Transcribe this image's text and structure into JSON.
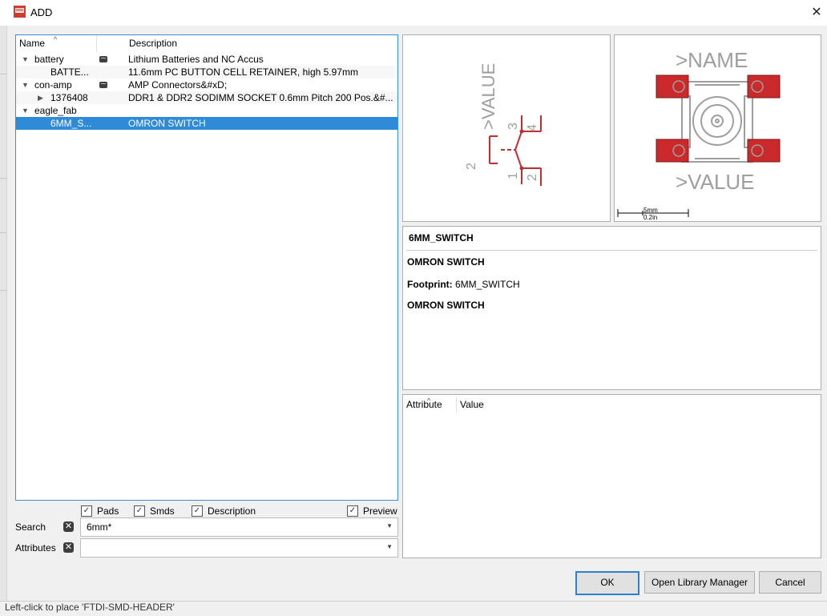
{
  "window": {
    "title": "ADD",
    "close_glyph": "✕",
    "icon": "eagle-sch-icon"
  },
  "tree": {
    "col_name": "Name",
    "col_desc": "Description",
    "sort_caret": "^",
    "rows": [
      {
        "name": "battery",
        "desc": "Lithium Batteries and NC Accus"
      },
      {
        "name": "BATTE...",
        "desc": "11.6mm PC BUTTON CELL RETAINER, high 5.97mm"
      },
      {
        "name": "con-amp",
        "desc": "AMP Connectors&#xD;"
      },
      {
        "name": "1376408",
        "desc": "DDR1 & DDR2 SODIMM SOCKET 0.6mm Pitch 200 Pos.&#..."
      },
      {
        "name": "eagle_fab",
        "desc": ""
      },
      {
        "name": "6MM_S...",
        "desc": "OMRON SWITCH"
      }
    ]
  },
  "filters": {
    "pads": "Pads",
    "smds": "Smds",
    "description": "Description",
    "preview": "Preview",
    "check": "✓"
  },
  "search": {
    "label": "Search",
    "value": "6mm*",
    "attributes_label": "Attributes",
    "attributes_value": "",
    "clear_glyph": "✕",
    "dropdown_glyph": "▼"
  },
  "symbol_preview": {
    "value_text": ">VALUE",
    "pin_1": "1",
    "pin_2": "2",
    "pin_3": "3",
    "pin_4": "4"
  },
  "footprint_preview": {
    "name_text": ">NAME",
    "value_text": ">VALUE",
    "scale_top": "5mm",
    "scale_bottom": "0.2in"
  },
  "info": {
    "title": "6MM_SWITCH",
    "line1": "OMRON SWITCH",
    "footprint_label": "Footprint:",
    "footprint_value": "6MM_SWITCH",
    "line2": "OMRON SWITCH"
  },
  "attributes_table": {
    "col_attribute": "Attribute",
    "col_value": "Value"
  },
  "buttons": {
    "ok": "OK",
    "library_manager": "Open Library Manager",
    "cancel": "Cancel"
  },
  "status": "Left-click to place 'FTDI-SMD-HEADER'",
  "colors": {
    "accent": "#2f8ad8",
    "pad_red": "#cc2a2a",
    "symbol_red": "#c03030",
    "outline_gray": "#9e9e9e"
  }
}
